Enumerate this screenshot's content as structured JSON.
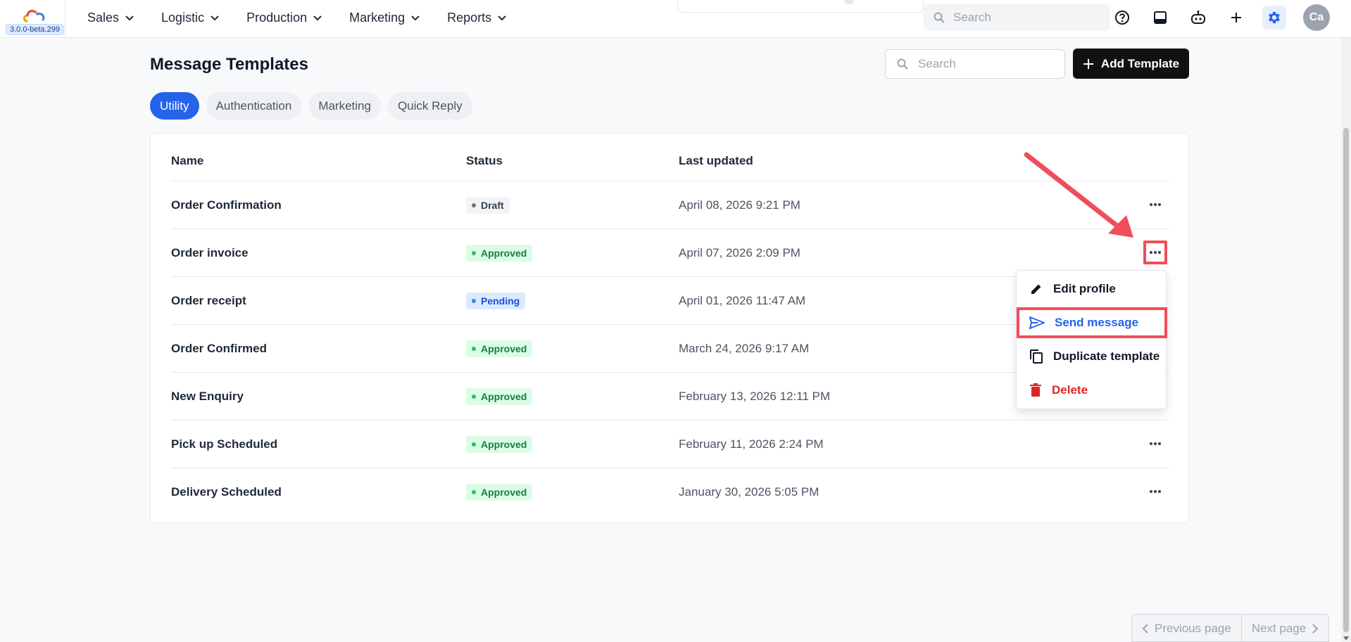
{
  "app": {
    "version": "3.0.0-beta.299",
    "nav": [
      "Sales",
      "Logistic",
      "Production",
      "Marketing",
      "Reports"
    ],
    "search_placeholder": "Search",
    "avatar_initials": "Ca",
    "accent_color": "#2563eb"
  },
  "page": {
    "title": "Message Templates",
    "search_placeholder": "Search",
    "add_button": "Add Template",
    "tabs": [
      {
        "label": "Utility",
        "active": true
      },
      {
        "label": "Authentication",
        "active": false
      },
      {
        "label": "Marketing",
        "active": false
      },
      {
        "label": "Quick Reply",
        "active": false
      }
    ]
  },
  "table": {
    "columns": [
      "Name",
      "Status",
      "Last updated"
    ],
    "rows": [
      {
        "name": "Order Confirmation",
        "status": "Draft",
        "updated": "April 08, 2026 9:21 PM"
      },
      {
        "name": "Order invoice",
        "status": "Approved",
        "updated": "April 07, 2026 2:09 PM"
      },
      {
        "name": "Order receipt",
        "status": "Pending",
        "updated": "April 01, 2026 11:47 AM"
      },
      {
        "name": "Order Confirmed",
        "status": "Approved",
        "updated": "March 24, 2026 9:17 AM"
      },
      {
        "name": "New Enquiry",
        "status": "Approved",
        "updated": "February 13, 2026 12:11 PM"
      },
      {
        "name": "Pick up Scheduled",
        "status": "Approved",
        "updated": "February 11, 2026 2:24 PM"
      },
      {
        "name": "Delivery Scheduled",
        "status": "Approved",
        "updated": "January 30, 2026 5:05 PM"
      }
    ],
    "status_colors": {
      "Draft": {
        "bg": "#f3f4f6",
        "fg": "#374151",
        "dot": "#6b7280"
      },
      "Approved": {
        "bg": "#dcfce7",
        "fg": "#15803d",
        "dot": "#22c55e"
      },
      "Pending": {
        "bg": "#dbeafe",
        "fg": "#1d4ed8",
        "dot": "#3b82f6"
      }
    }
  },
  "menu": {
    "items": [
      {
        "label": "Edit profile",
        "icon": "pencil-icon"
      },
      {
        "label": "Send message",
        "icon": "send-icon"
      },
      {
        "label": "Duplicate template",
        "icon": "copy-icon"
      },
      {
        "label": "Delete",
        "icon": "trash-icon"
      }
    ]
  },
  "pagination": {
    "prev": "Previous page",
    "next": "Next page"
  }
}
